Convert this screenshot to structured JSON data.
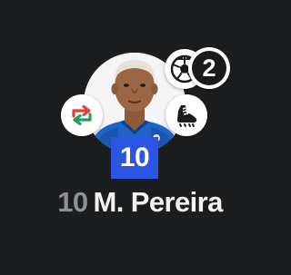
{
  "player": {
    "number": "10",
    "name": "M. Pereira"
  },
  "goals": {
    "count": "2"
  },
  "icons": {
    "goal": "football-icon",
    "substitution": "substitution-arrows-icon",
    "assist": "boot-icon",
    "photo": "player-photo"
  },
  "colors": {
    "background": "#1c1d1f",
    "shirt_number_bg": "#2d55e3",
    "sub_in": "#1aa05b",
    "sub_out": "#e0413b",
    "number_text": "#8f9194"
  }
}
